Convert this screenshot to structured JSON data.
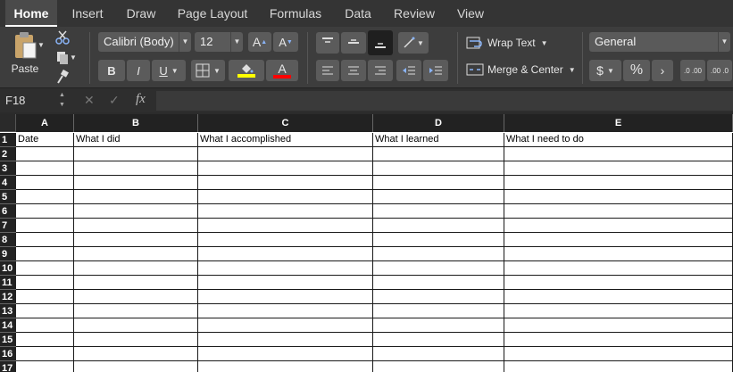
{
  "tabs": [
    {
      "label": "Home",
      "active": true
    },
    {
      "label": "Insert"
    },
    {
      "label": "Draw"
    },
    {
      "label": "Page Layout"
    },
    {
      "label": "Formulas"
    },
    {
      "label": "Data"
    },
    {
      "label": "Review"
    },
    {
      "label": "View"
    }
  ],
  "ribbon": {
    "paste_label": "Paste",
    "font_name": "Calibri (Body)",
    "font_size": "12",
    "bold": "B",
    "italic": "I",
    "underline": "U",
    "wrap_text": "Wrap Text",
    "merge_center": "Merge & Center",
    "number_format": "General",
    "currency": "$",
    "percent": "%",
    "comma": "›",
    "grow_font": "A",
    "shrink_font": "A",
    "inc_decimal": ".0 .00",
    "dec_decimal": ".00 .0",
    "highlight_color": "#ffff00",
    "font_color": "#ff0000"
  },
  "formula_bar": {
    "cell_ref": "F18",
    "cancel_glyph": "✕",
    "enter_glyph": "✓",
    "fx_label": "fx",
    "value": ""
  },
  "sheet": {
    "columns": [
      "A",
      "B",
      "C",
      "D",
      "E"
    ],
    "rows": [
      "1",
      "2",
      "3",
      "4",
      "5",
      "6",
      "7",
      "8",
      "9",
      "10",
      "11",
      "12",
      "13",
      "14",
      "15",
      "16",
      "17"
    ],
    "row1": [
      "Date",
      "What I did",
      "What I accomplished",
      "What I learned",
      "What I need to do"
    ]
  },
  "colors": {
    "accent_background": "#3d3d3d",
    "grid_background": "#ffffff",
    "header_background": "#222222"
  }
}
